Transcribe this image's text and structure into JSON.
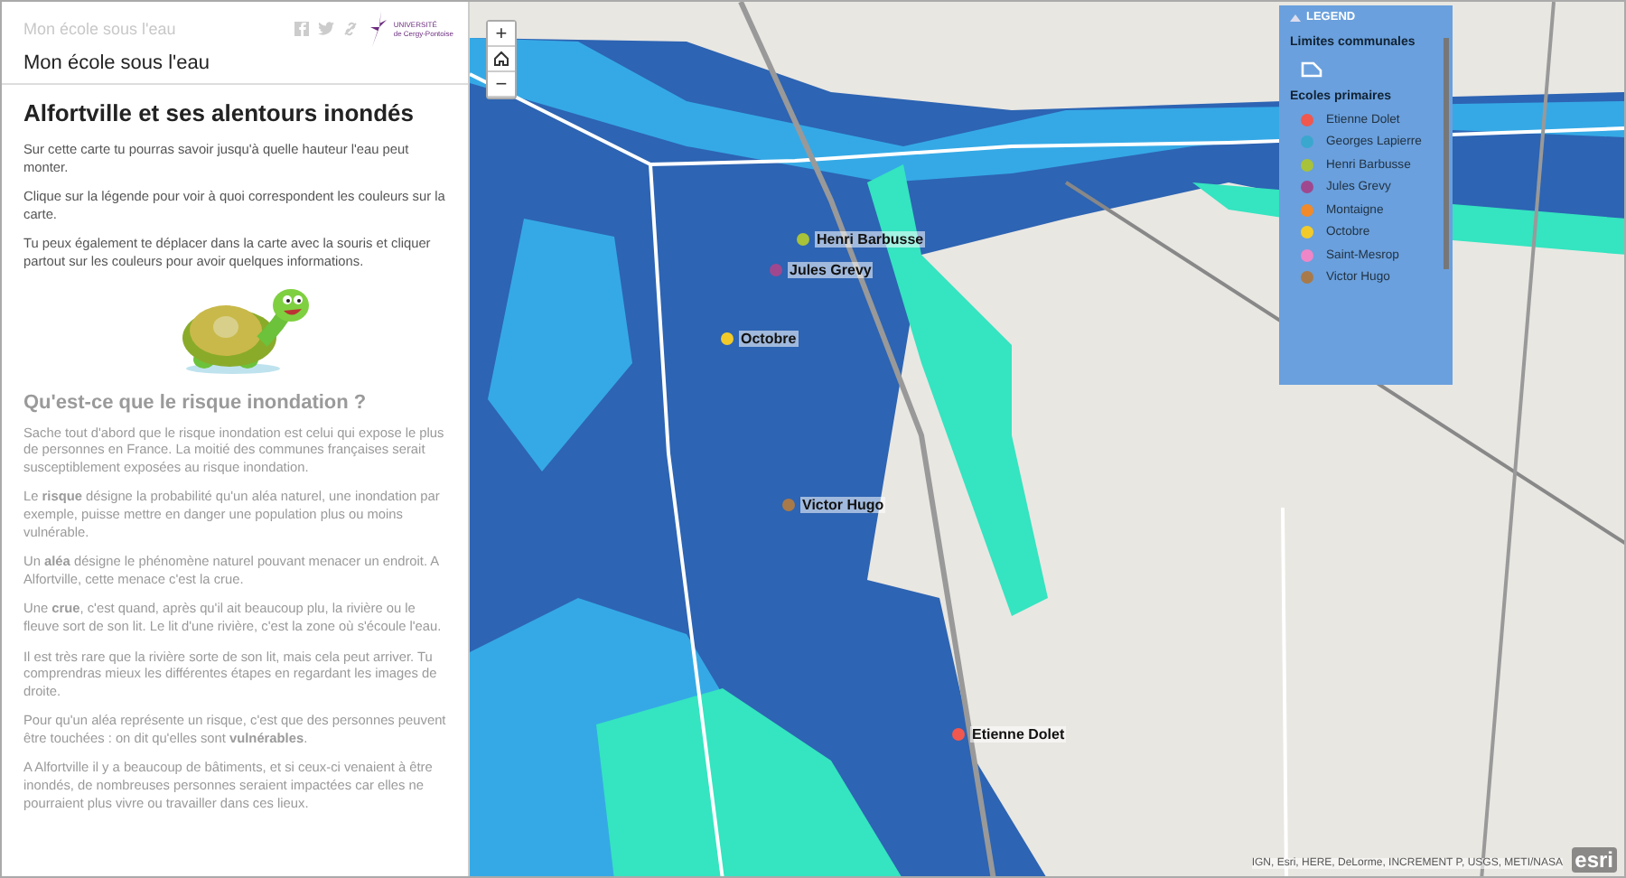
{
  "header": {
    "site_title": "Mon école sous l'eau",
    "title": "Mon école sous l'eau",
    "logo": {
      "line1": "UNIVERSITÉ",
      "line2": "de Cergy-Pontoise"
    }
  },
  "story": {
    "heading": "Alfortville et ses alentours inondés",
    "paragraphs": [
      "Sur cette carte tu pourras savoir jusqu'à quelle hauteur l'eau peut monter.",
      "Clique sur la légende pour voir à quoi correspondent les couleurs sur la carte.",
      "Tu peux également te déplacer dans la carte avec la souris et cliquer partout sur les couleurs pour avoir quelques informations."
    ],
    "faded_heading": "Qu'est-ce que le risque inondation ?",
    "faded_paragraphs": [
      "Sache tout d'abord que le risque inondation est celui qui expose le plus de personnes en France. La moitié des communes françaises serait susceptiblement exposées au risque inondation.",
      "Le **risque** désigne la probabilité qu'un aléa naturel, une inondation par exemple, puisse mettre en danger une population plus ou moins vulnérable.",
      "Un **aléa** désigne le phénomène naturel pouvant menacer un endroit. A Alfortville, cette menace c'est la crue.",
      "Une **crue**, c'est quand, après qu'il ait beaucoup plu, la rivière ou le fleuve sort de son lit. Le lit d'une rivière, c'est la zone où s'écoule l'eau.",
      "Il est très rare que la rivière sorte de son lit, mais cela peut arriver. Tu comprendras mieux les différentes étapes en regardant les images de droite.",
      "Pour qu'un aléa représente un risque, c'est que des personnes peuvent être touchées : on dit qu'elles sont **vulnérables**.",
      "A Alfortville il y a beaucoup de bâtiments, et si ceux-ci venaient à être inondés, de nombreuses personnes seraient impactées car elles ne pourraient plus vivre ou travailler dans ces lieux."
    ]
  },
  "map": {
    "zoom_in": "+",
    "zoom_out": "−",
    "markers": [
      {
        "label": "Henri Barbusse",
        "color": "#a8c23a"
      },
      {
        "label": "Jules Grevy",
        "color": "#a0488f"
      },
      {
        "label": "Octobre",
        "color": "#f2cb2a"
      },
      {
        "label": "Victor Hugo",
        "color": "#a87a4a"
      },
      {
        "label": "Etienne Dolet",
        "color": "#f0574f"
      }
    ],
    "attribution": "IGN, Esri, HERE, DeLorme, INCREMENT P, USGS, METI/NASA",
    "esri": "esri"
  },
  "legend": {
    "title": "LEGEND",
    "expanded": true,
    "section1": "Limites communales",
    "section2": "Ecoles primaires",
    "items": [
      {
        "label": "Etienne Dolet",
        "color": "#f0574f"
      },
      {
        "label": "Georges Lapierre",
        "color": "#3aa7cf"
      },
      {
        "label": "Henri Barbusse",
        "color": "#a8c23a"
      },
      {
        "label": "Jules Grevy",
        "color": "#a0488f"
      },
      {
        "label": "Montaigne",
        "color": "#f08a2a"
      },
      {
        "label": "Octobre",
        "color": "#f2cb2a"
      },
      {
        "label": "Saint-Mesrop",
        "color": "#ef86c8"
      },
      {
        "label": "Victor Hugo",
        "color": "#a87a4a"
      }
    ]
  }
}
